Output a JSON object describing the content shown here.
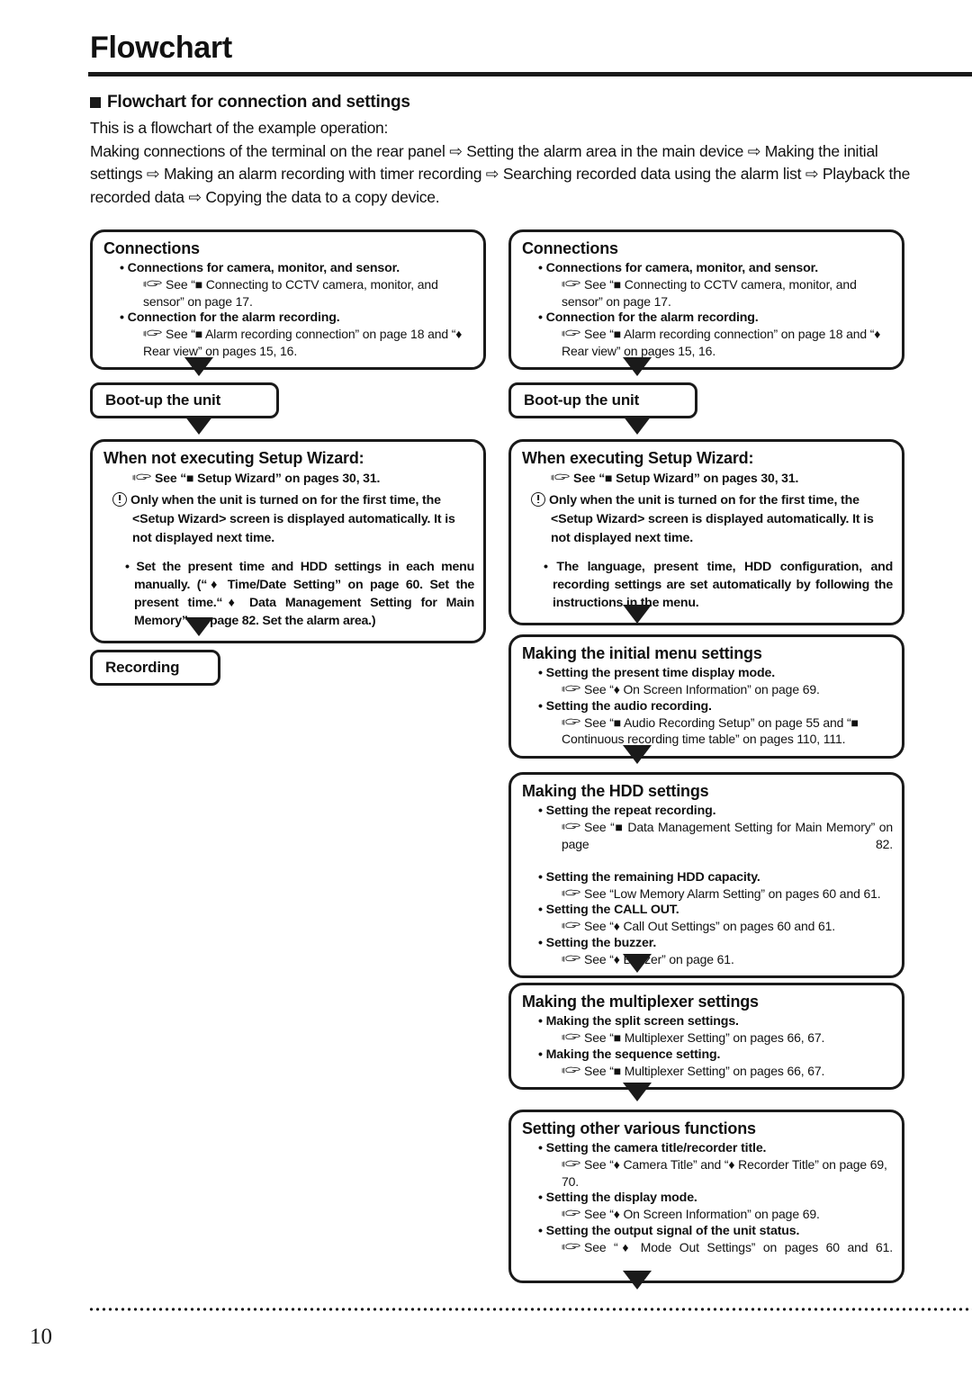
{
  "header": {
    "title": "Flowchart",
    "section_heading": "Flowchart for connection and settings",
    "intro_lead": "This is a flowchart of the example operation:",
    "intro_body": "Making connections of the terminal on the rear panel ⇨ Setting the alarm area in the main device ⇨ Making the initial settings ⇨ Making an alarm recording with timer recording ⇨ Searching recorded data using the alarm list ⇨ Playback the recorded data ⇨ Copying the data to a copy device."
  },
  "icons": {
    "hand": "pointing-hand-icon",
    "warning": "exclamation-circle-icon",
    "square": "black-square-bullet",
    "diamond": "black-diamond-bullet",
    "arrow_down": "down-triangle-arrow"
  },
  "left_column": {
    "connections": {
      "title": "Connections",
      "items": [
        {
          "label": "Connections for camera, monitor, and sensor.",
          "ref": "See “■ Connecting to CCTV camera, monitor, and sensor” on page 17."
        },
        {
          "label": "Connection for the alarm recording.",
          "ref": "See “■ Alarm recording connection” on page 18 and “♦ Rear view” on pages 15, 16."
        }
      ]
    },
    "bootup": {
      "title": "Boot-up the unit"
    },
    "wizard": {
      "title": "When not executing Setup Wizard:",
      "ref": "See “■ Setup Wizard” on pages 30, 31.",
      "note": "Only when the unit is turned on for the first time, the <Setup Wizard> screen is displayed automatically. It is not displayed next time.",
      "bullet": "Set the present time and HDD settings in each menu manually. (“♦ Time/Date Setting” on page 60. Set the present time.“♦ Data Management Setting for Main Memory” on page 82. Set the alarm area.)"
    },
    "recording": {
      "title": "Recording"
    }
  },
  "right_column": {
    "connections": {
      "title": "Connections",
      "items": [
        {
          "label": "Connections for camera, monitor, and sensor.",
          "ref": "See “■ Connecting to CCTV camera, monitor, and sensor” on page 17."
        },
        {
          "label": "Connection for the alarm recording.",
          "ref": "See “■ Alarm recording connection” on page 18 and “♦ Rear view” on pages 15, 16."
        }
      ]
    },
    "bootup": {
      "title": "Boot-up the unit"
    },
    "wizard": {
      "title": "When executing Setup Wizard:",
      "ref": "See “■ Setup Wizard” on pages 30, 31.",
      "note": "Only when the unit is turned on for the first time, the <Setup Wizard> screen is displayed automatically. It is not displayed next time.",
      "bullet": "The language, present time, HDD configuration, and recording settings are set automatically by following the instructions in the menu."
    },
    "initial_menu": {
      "title": "Making the initial menu settings",
      "items": [
        {
          "label": "Setting the present time display mode.",
          "ref": "See “♦ On Screen Information” on page 69."
        },
        {
          "label": "Setting the audio recording.",
          "ref": "See “■ Audio Recording Setup” on page 55 and “■ Continuous recording time table” on pages 110, 111."
        }
      ]
    },
    "hdd_settings": {
      "title": "Making the HDD settings",
      "items": [
        {
          "label": "Setting the repeat recording.",
          "ref": "See “■ Data Management Setting for Main Memory” on page 82."
        },
        {
          "label": "Setting the remaining HDD capacity.",
          "ref": "See “Low Memory Alarm Setting” on pages 60 and 61."
        },
        {
          "label": "Setting the CALL OUT.",
          "ref": "See “♦ Call Out Settings” on pages 60 and 61."
        },
        {
          "label": "Setting the buzzer.",
          "ref": "See “♦ Buzzer” on page 61."
        }
      ]
    },
    "multiplexer": {
      "title": "Making the multiplexer settings",
      "items": [
        {
          "label": "Making the split screen settings.",
          "ref": "See “■ Multiplexer Setting” on pages 66, 67."
        },
        {
          "label": "Making the sequence setting.",
          "ref": "See “■ Multiplexer Setting” on pages 66, 67."
        }
      ]
    },
    "other_functions": {
      "title": "Setting other various functions",
      "items": [
        {
          "label": "Setting the camera title/recorder title.",
          "ref": "See “♦ Camera Title” and “♦ Recorder Title” on page 69, 70."
        },
        {
          "label": "Setting the display mode.",
          "ref": "See “♦ On Screen Information” on page 69."
        },
        {
          "label": "Setting the output signal of the unit status.",
          "ref": "See “♦ Mode Out Settings” on pages 60 and 61."
        }
      ]
    }
  },
  "footer": {
    "page_number": "10"
  }
}
